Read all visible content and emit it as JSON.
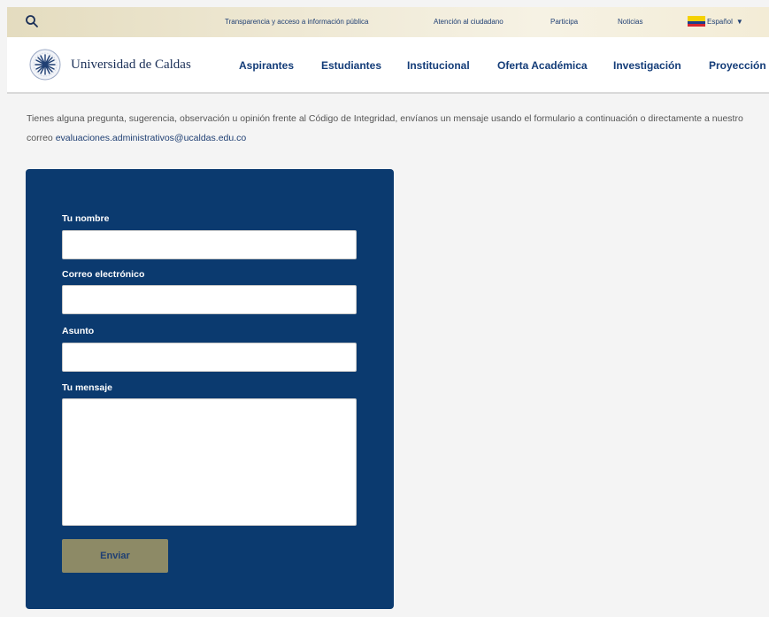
{
  "topbar": {
    "search_icon": "search-icon",
    "links": [
      "Transparencia y acceso a información pública",
      "Atención al ciudadano",
      "Participa",
      "Noticias"
    ],
    "language": "Español",
    "colors": {
      "background": "#efe9d5",
      "text": "#1f3f73"
    }
  },
  "nav": {
    "brand": "Universidad de Caldas",
    "logo_icon": "university-seal-icon",
    "items": [
      "Aspirantes",
      "Estudiantes",
      "Institucional",
      "Oferta Académica",
      "Investigación",
      "Proyección"
    ],
    "colors": {
      "text": "#133c78"
    }
  },
  "intro": {
    "text": "Tienes alguna pregunta, sugerencia, observación u opinión frente al Código de Integridad, envíanos un mensaje usando el formulario a continuación o directamente a nuestro correo ",
    "email": "evaluaciones.administrativos@ucaldas.edu.co"
  },
  "form": {
    "name_label": "Tu nombre",
    "name_value": "",
    "email_label": "Correo electrónico",
    "email_value": "",
    "subject_label": "Asunto",
    "subject_value": "",
    "message_label": "Tu mensaje",
    "message_value": "",
    "submit_label": "Enviar",
    "colors": {
      "panel": "#0b3a6f",
      "button": "#8d8a66"
    }
  }
}
